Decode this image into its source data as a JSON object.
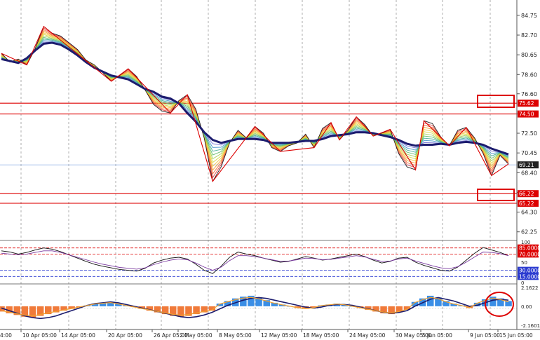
{
  "chart_data": [
    {
      "type": "candlestick",
      "panel": "price",
      "ylim": [
        61.5,
        86.2
      ],
      "price_ticks": [
        "84.75",
        "82.70",
        "80.65",
        "78.60",
        "76.60",
        "74.50",
        "72.50",
        "70.45",
        "68.40",
        "66.35",
        "64.30",
        "62.25"
      ],
      "series": [
        {
          "name": "",
          "values": [
            80.8,
            79.9,
            80.2,
            79.6,
            81.3,
            83.6,
            82.9,
            82.6,
            81.9,
            81.2,
            80.1,
            79.6,
            78.8,
            77.9,
            78.5,
            79.2,
            78.4,
            77.0,
            75.5,
            74.8,
            74.6,
            75.9,
            76.5,
            75.0,
            72.0,
            67.5,
            69.0,
            71.5,
            72.8,
            72.0,
            73.2,
            72.5,
            71.0,
            70.6,
            71.2,
            71.5,
            72.4,
            71.0,
            73.0,
            73.6,
            71.8,
            72.8,
            74.2,
            73.4,
            72.2,
            72.5,
            72.9,
            70.4,
            69.0,
            68.7,
            73.8,
            73.5,
            72.1,
            71.2,
            72.8,
            73.1,
            72.0,
            70.4,
            68.1,
            70.2,
            69.3
          ]
        },
        {
          "name": "",
          "values": [
            80.2,
            80.0,
            79.8,
            80.3,
            81.1,
            81.8,
            81.9,
            81.7,
            81.2,
            80.6,
            79.9,
            79.3,
            78.9,
            78.5,
            78.3,
            78.1,
            77.6,
            77.1,
            76.8,
            76.3,
            76.1,
            75.6,
            74.6,
            73.7,
            72.6,
            71.8,
            71.5,
            71.7,
            71.9,
            71.9,
            71.9,
            71.8,
            71.5,
            71.5,
            71.5,
            71.6,
            71.7,
            71.7,
            71.9,
            72.2,
            72.3,
            72.4,
            72.6,
            72.6,
            72.5,
            72.3,
            72.1,
            71.8,
            71.4,
            71.2,
            71.3,
            71.3,
            71.4,
            71.3,
            71.5,
            71.6,
            71.5,
            71.3,
            70.9,
            70.6,
            70.3
          ]
        }
      ],
      "right_labels": [
        {
          "text": "75.62",
          "value": 75.62,
          "style": "red"
        },
        {
          "text": "74.50",
          "value": 74.5,
          "style": "red"
        },
        {
          "text": "69.21",
          "value": 69.21,
          "style": "dark"
        },
        {
          "text": "66.22",
          "value": 66.22,
          "style": "red"
        },
        {
          "text": "65.22",
          "value": 65.22,
          "style": "red"
        }
      ],
      "horizontal_levels": [
        75.62,
        74.5,
        66.22,
        65.22
      ],
      "current_price": 69.21
    },
    {
      "type": "line",
      "panel": "oscillator",
      "ylim": [
        0,
        100
      ],
      "levels": [
        85,
        70,
        30,
        15
      ],
      "axis_labels": [
        "100",
        "50",
        "0"
      ],
      "right_labels": [
        {
          "text": "85.0000",
          "value": 85,
          "style": "red"
        },
        {
          "text": "70.0000",
          "value": 70,
          "style": "red"
        },
        {
          "text": "30.0000",
          "value": 30,
          "style": "blue"
        },
        {
          "text": "15.0000",
          "value": 15,
          "style": "blue"
        }
      ],
      "series": [
        {
          "name": "",
          "values": [
            78,
            75,
            70,
            74,
            80,
            85,
            82,
            76,
            68,
            60,
            52,
            45,
            40,
            36,
            32,
            30,
            28,
            35,
            48,
            55,
            60,
            62,
            58,
            45,
            30,
            22,
            40,
            62,
            75,
            70,
            66,
            60,
            55,
            50,
            52,
            58,
            64,
            60,
            55,
            58,
            62,
            66,
            70,
            64,
            55,
            48,
            52,
            60,
            62,
            50,
            42,
            36,
            30,
            28,
            38,
            55,
            72,
            86,
            80,
            74,
            66
          ]
        },
        {
          "name": "",
          "values": [
            72,
            70,
            68,
            70,
            74,
            78,
            78,
            74,
            68,
            62,
            56,
            50,
            45,
            41,
            37,
            35,
            33,
            36,
            44,
            50,
            55,
            58,
            56,
            48,
            38,
            30,
            38,
            54,
            66,
            66,
            64,
            60,
            56,
            52,
            53,
            56,
            60,
            59,
            56,
            57,
            60,
            63,
            66,
            63,
            57,
            52,
            53,
            58,
            60,
            53,
            47,
            41,
            36,
            34,
            39,
            50,
            63,
            75,
            74,
            71,
            66
          ]
        }
      ]
    },
    {
      "type": "bar",
      "panel": "macd",
      "ylim": [
        -2.5,
        2.4
      ],
      "axis_labels": [
        "2.1622",
        "0.00",
        "-2.1601"
      ],
      "values": [
        -0.6,
        -0.8,
        -1.0,
        -1.2,
        -1.3,
        -1.1,
        -0.9,
        -0.7,
        -0.5,
        -0.3,
        -0.1,
        0.1,
        0.3,
        0.4,
        0.5,
        0.3,
        0.1,
        -0.1,
        -0.3,
        -0.5,
        -0.7,
        -0.9,
        -1.1,
        -1.2,
        -1.1,
        -0.9,
        -0.7,
        -0.5,
        0.3,
        0.6,
        0.9,
        1.1,
        1.2,
        1.0,
        0.7,
        0.4,
        0.2,
        0.0,
        -0.2,
        -0.3,
        -0.2,
        0.1,
        0.2,
        0.3,
        0.2,
        0.0,
        -0.2,
        -0.4,
        -0.6,
        -0.8,
        -0.9,
        -0.7,
        -0.4,
        0.5,
        0.9,
        1.2,
        1.0,
        0.6,
        0.3,
        0.1,
        -0.2,
        0.4,
        0.8,
        1.1,
        0.9,
        0.6
      ],
      "signal": [
        -0.2,
        -0.5,
        -0.8,
        -1.1,
        -1.3,
        -1.4,
        -1.3,
        -1.1,
        -0.8,
        -0.5,
        -0.2,
        0.1,
        0.3,
        0.4,
        0.5,
        0.4,
        0.2,
        0.0,
        -0.2,
        -0.4,
        -0.6,
        -0.8,
        -1.0,
        -1.2,
        -1.3,
        -1.2,
        -1.0,
        -0.7,
        -0.3,
        0.1,
        0.4,
        0.7,
        0.9,
        1.0,
        0.9,
        0.7,
        0.5,
        0.3,
        0.1,
        -0.1,
        -0.2,
        -0.1,
        0.1,
        0.2,
        0.2,
        0.1,
        -0.1,
        -0.3,
        -0.5,
        -0.7,
        -0.8,
        -0.7,
        -0.5,
        0.0,
        0.4,
        0.8,
        1.0,
        0.8,
        0.6,
        0.3,
        0.0,
        0.1,
        0.4,
        0.7,
        0.8,
        0.7
      ]
    }
  ],
  "time_axis": {
    "labels": [
      "10 Apr 05:00",
      "14 Apr 05:00",
      "20 Apr 05:00",
      "26 Apr 05:00",
      "2 May 05:00",
      "8 May 05:00",
      "12 May 05:00",
      "18 May 05:00",
      "24 May 05:00",
      "30 May 05:00",
      "5 Jun 05:00",
      "9 Jun 05:00",
      "15 Jun 05:00"
    ],
    "first_label": "4:00"
  },
  "colors": {
    "background": "#ffffff",
    "grid": "#8c8c8c",
    "red": "#dd0000",
    "ma_dark": "#1c1c6e",
    "hist_up": "#3a8ee6",
    "hist_down": "#f07a3a",
    "signal": "#1c1c6e"
  }
}
